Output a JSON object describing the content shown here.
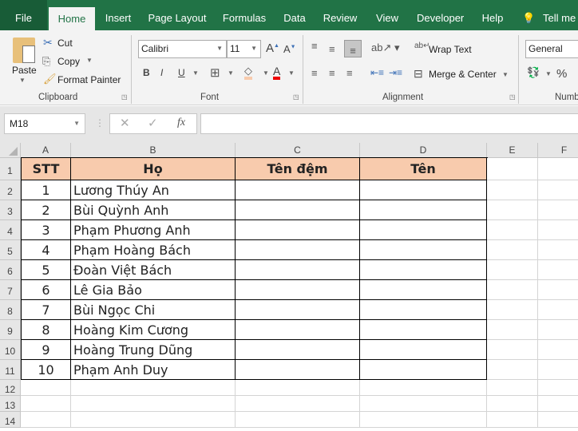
{
  "tabs": [
    "File",
    "Home",
    "Insert",
    "Page Layout",
    "Formulas",
    "Data",
    "Review",
    "View",
    "Developer",
    "Help",
    "Tell me"
  ],
  "clipboard": {
    "paste": "Paste",
    "cut": "Cut",
    "copy": "Copy",
    "format_painter": "Format Painter",
    "group": "Clipboard"
  },
  "font": {
    "name": "Calibri",
    "size": "11",
    "group": "Font",
    "bold": "B",
    "italic": "I",
    "underline": "U"
  },
  "alignment": {
    "wrap": "Wrap Text",
    "merge": "Merge & Center",
    "group": "Alignment"
  },
  "number": {
    "format": "General",
    "group": "Numb",
    "percent": "%"
  },
  "formula_bar": {
    "name_box": "M18",
    "fx": "fx",
    "value": ""
  },
  "columns": [
    "A",
    "B",
    "C",
    "D",
    "E",
    "F"
  ],
  "rows": [
    "1",
    "2",
    "3",
    "4",
    "5",
    "6",
    "7",
    "8",
    "9",
    "10",
    "11",
    "12",
    "13",
    "14"
  ],
  "headers": [
    "STT",
    "Họ",
    "Tên đệm",
    "Tên"
  ],
  "data": [
    {
      "stt": "1",
      "ho": "Lương Thúy An"
    },
    {
      "stt": "2",
      "ho": "Bùi Quỳnh Anh"
    },
    {
      "stt": "3",
      "ho": "Phạm Phương Anh"
    },
    {
      "stt": "4",
      "ho": "Phạm Hoàng Bách"
    },
    {
      "stt": "5",
      "ho": "Đoàn Việt Bách"
    },
    {
      "stt": "6",
      "ho": "Lê Gia Bảo"
    },
    {
      "stt": "7",
      "ho": "Bùi Ngọc Chi"
    },
    {
      "stt": "8",
      "ho": "Hoàng Kim Cương"
    },
    {
      "stt": "9",
      "ho": "Hoàng Trung Dũng"
    },
    {
      "stt": "10",
      "ho": "Phạm Anh Duy"
    }
  ],
  "colors": {
    "brand": "#217346",
    "header_fill": "#f8cbad"
  }
}
